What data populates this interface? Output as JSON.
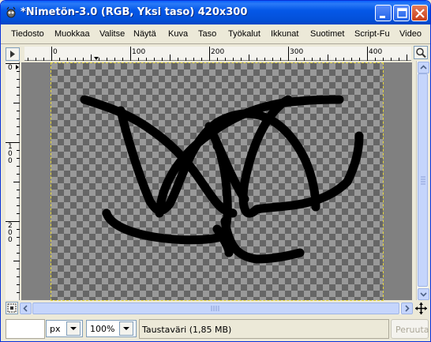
{
  "window": {
    "title": "*Nimetön-3.0 (RGB, Yksi taso) 420x300"
  },
  "menubar": {
    "items": [
      {
        "label": "Tiedosto"
      },
      {
        "label": "Muokkaa"
      },
      {
        "label": "Valitse"
      },
      {
        "label": "Näytä"
      },
      {
        "label": "Kuva"
      },
      {
        "label": "Taso"
      },
      {
        "label": "Työkalut"
      },
      {
        "label": "Ikkunat"
      },
      {
        "label": "Suotimet"
      },
      {
        "label": "Script-Fu"
      },
      {
        "label": "Video"
      }
    ]
  },
  "rulers": {
    "horizontal": [
      "0",
      "100",
      "200",
      "300",
      "400"
    ],
    "vertical": [
      "0",
      "1\n0\n0",
      "2\n0\n0"
    ]
  },
  "statusbar": {
    "unit": "px",
    "zoom": "100%",
    "message": "Taustaväri (1,85 MB)",
    "cancel_label": "Peruuta"
  },
  "colors": {
    "titlebar": "#0558e8",
    "stroke": "#000000",
    "checker_dark": "#666666",
    "checker_light": "#999999",
    "selection_border": "#e8d83a"
  }
}
